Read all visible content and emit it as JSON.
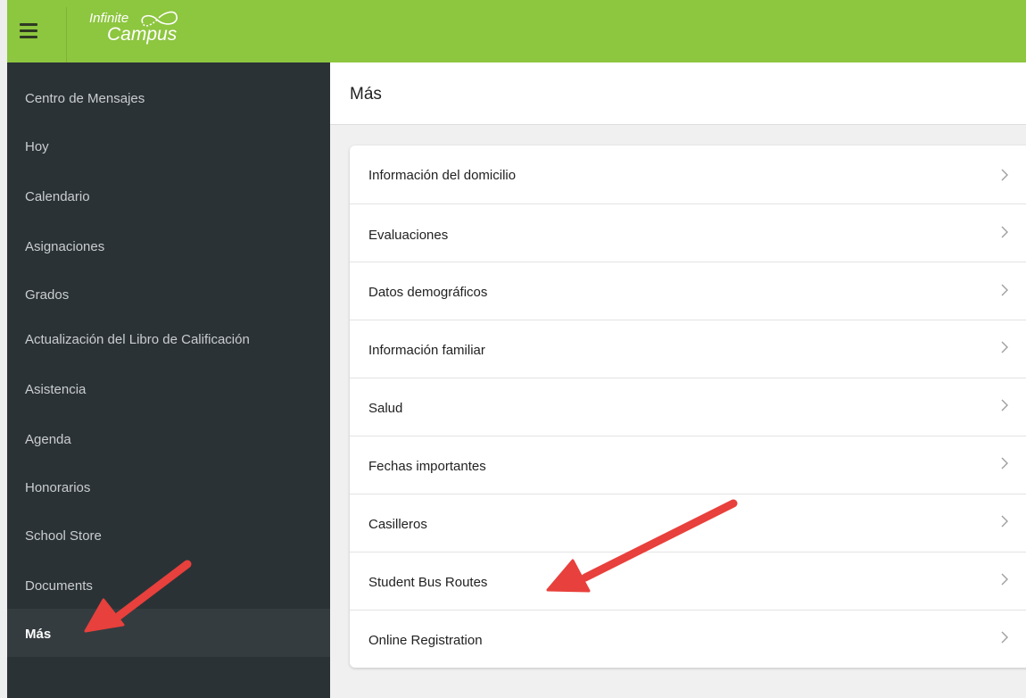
{
  "header": {
    "menu_icon": "hamburger-icon",
    "logo_line1": "Infinite",
    "logo_line2": "Campus",
    "brand_color": "#8dc63f"
  },
  "sidebar": {
    "background": "#2b3236",
    "items": [
      {
        "label": "Centro de Mensajes"
      },
      {
        "label": "Hoy"
      },
      {
        "label": "Calendario"
      },
      {
        "label": "Asignaciones"
      },
      {
        "label": "Grados"
      },
      {
        "label": "Actualización del Libro de Calificación"
      },
      {
        "label": "Asistencia"
      },
      {
        "label": "Agenda"
      },
      {
        "label": "Honorarios"
      },
      {
        "label": "School Store"
      },
      {
        "label": "Documents"
      },
      {
        "label": "Más",
        "active": true
      }
    ]
  },
  "main": {
    "title": "Más",
    "items": [
      {
        "label": "Información del domicilio"
      },
      {
        "label": "Evaluaciones"
      },
      {
        "label": "Datos demográficos"
      },
      {
        "label": "Información familiar"
      },
      {
        "label": "Salud"
      },
      {
        "label": "Fechas importantes"
      },
      {
        "label": "Casilleros"
      },
      {
        "label": "Student Bus Routes"
      },
      {
        "label": "Online Registration"
      }
    ],
    "row_icon": "chevron-right-icon"
  },
  "annotations": {
    "arrow_color": "#e8403c",
    "arrow_icon": "red-arrow-annotation"
  }
}
